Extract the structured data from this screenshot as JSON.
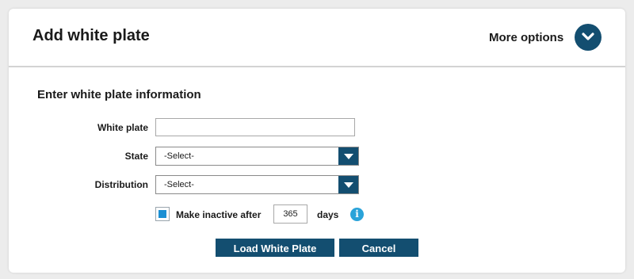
{
  "header": {
    "title": "Add white plate",
    "more_options_label": "More options",
    "more_options_icon": "chevron-down-icon"
  },
  "form": {
    "section_title": "Enter white plate information",
    "white_plate": {
      "label": "White plate",
      "value": ""
    },
    "state": {
      "label": "State",
      "value": "-Select-"
    },
    "distribution": {
      "label": "Distribution",
      "value": "-Select-"
    },
    "make_inactive": {
      "checked": true,
      "label": "Make inactive after",
      "days_value": "365",
      "days_label": "days",
      "info_icon": "info-icon"
    }
  },
  "actions": {
    "load_label": "Load White Plate",
    "cancel_label": "Cancel"
  },
  "colors": {
    "primary": "#134e70",
    "checkbox_fill": "#1b8fd3",
    "info": "#2aa3d9",
    "background": "#ececec"
  }
}
